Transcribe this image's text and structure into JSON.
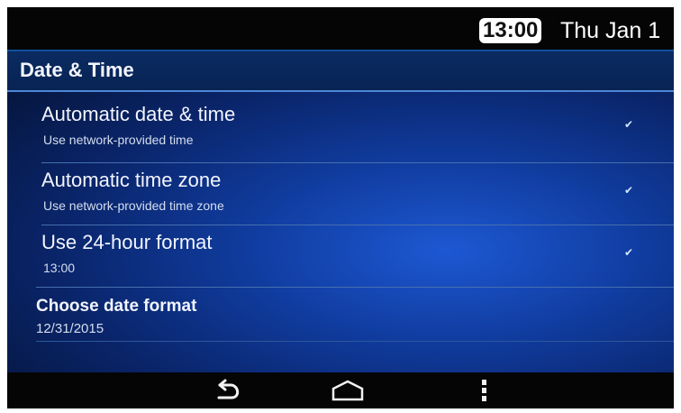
{
  "status_bar": {
    "time": "13:00",
    "date": "Thu Jan 1"
  },
  "header": {
    "title": "Date & Time"
  },
  "settings": {
    "items": [
      {
        "title": "Automatic date & time",
        "summary": "Use network-provided time",
        "checked": true
      },
      {
        "title": "Automatic time zone",
        "summary": "Use network-provided time zone",
        "checked": true
      },
      {
        "title": "Use 24-hour format",
        "summary": "13:00",
        "checked": true
      },
      {
        "title": "Choose date format",
        "summary": "12/31/2015"
      }
    ]
  },
  "nav": {
    "icons": [
      "back-icon",
      "home-icon",
      "overflow-menu-icon"
    ]
  },
  "colors": {
    "background": "#0a256b",
    "accent": "#4b87d6",
    "text": "#f2f5ff"
  }
}
